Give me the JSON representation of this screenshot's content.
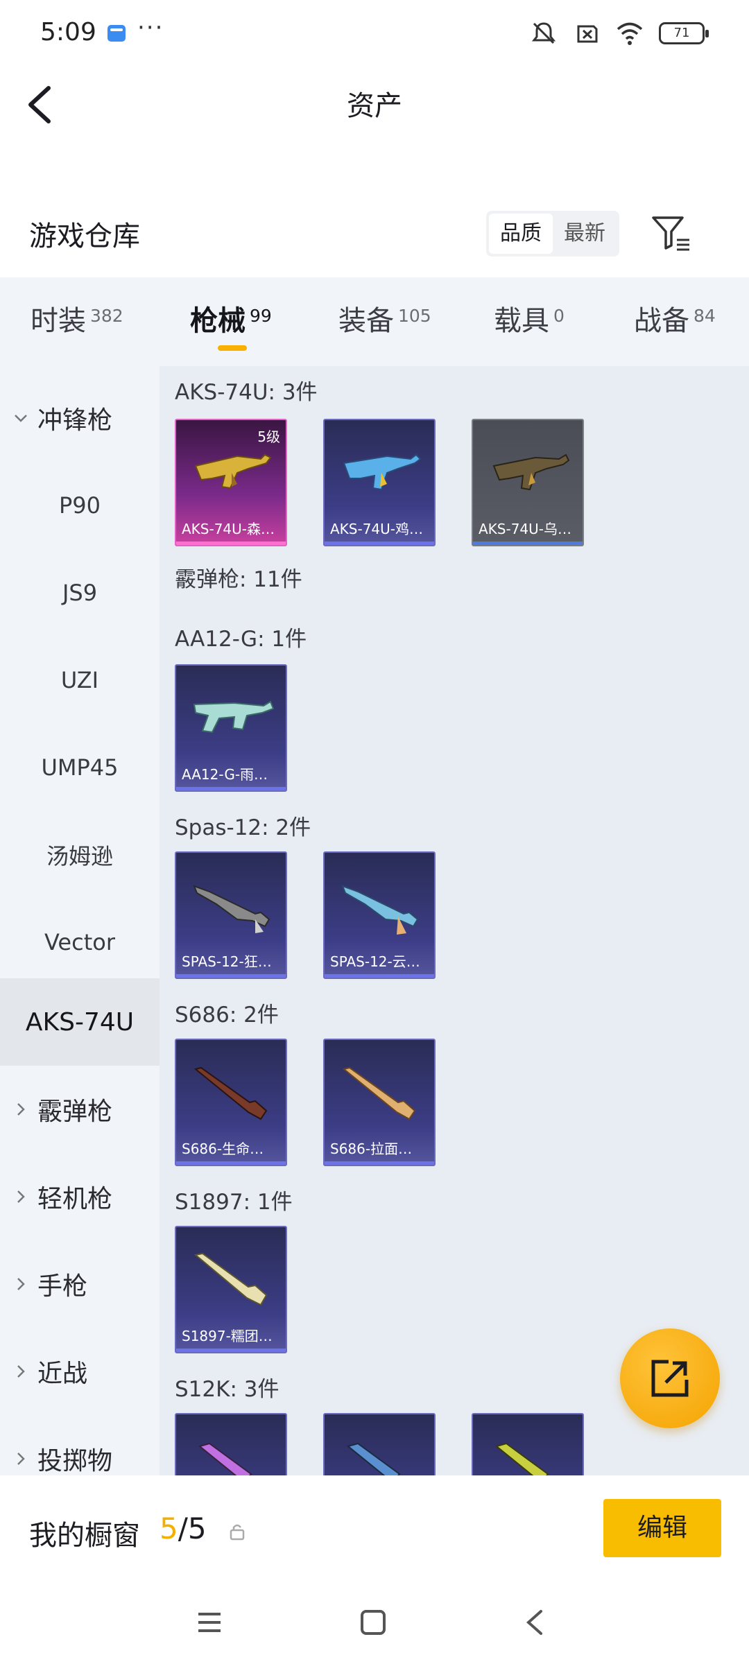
{
  "status_bar": {
    "time": "5:09",
    "more": "···",
    "battery": "71"
  },
  "header": {
    "title": "资产"
  },
  "warehouse": {
    "title": "游戏仓库",
    "sort_options": [
      "品质",
      "最新"
    ]
  },
  "tabs": [
    {
      "label": "时装",
      "count": "382"
    },
    {
      "label": "枪械",
      "count": "99"
    },
    {
      "label": "装备",
      "count": "105"
    },
    {
      "label": "载具",
      "count": "0"
    },
    {
      "label": "战备",
      "count": "84"
    }
  ],
  "sidebar": {
    "category_open": "冲锋枪",
    "subitems": [
      "P90",
      "JS9",
      "UZI",
      "UMP45",
      "汤姆逊",
      "Vector",
      "AKS-74U"
    ],
    "categories": [
      "霰弹枪",
      "轻机枪",
      "手枪",
      "近战",
      "投掷物"
    ]
  },
  "sections": [
    {
      "heading": "AKS-74U: 3件",
      "items": [
        "AKS-74U-森…",
        "AKS-74U-鸡…",
        "AKS-74U-乌…"
      ],
      "level": "5级"
    },
    {
      "heading": "霰弹枪: 11件"
    },
    {
      "heading": "AA12-G: 1件",
      "items": [
        "AA12-G-雨…"
      ]
    },
    {
      "heading": "Spas-12: 2件",
      "items": [
        "SPAS-12-狂…",
        "SPAS-12-云…"
      ]
    },
    {
      "heading": "S686: 2件",
      "items": [
        "S686-生命…",
        "S686-拉面…"
      ]
    },
    {
      "heading": "S1897: 1件",
      "items": [
        "S1897-糯团…"
      ]
    },
    {
      "heading": "S12K: 3件"
    }
  ],
  "showcase": {
    "title": "我的橱窗",
    "current": "5",
    "total": "/5",
    "edit_label": "编辑"
  },
  "colors": {
    "accent": "#f8bc00",
    "card_purple": "#3c3d86",
    "card_gold": "#c8409e"
  },
  "icons": [
    "back-arrow-icon",
    "filter-icon",
    "share-icon",
    "lock-icon",
    "menu-icon",
    "home-icon",
    "back-icon"
  ]
}
